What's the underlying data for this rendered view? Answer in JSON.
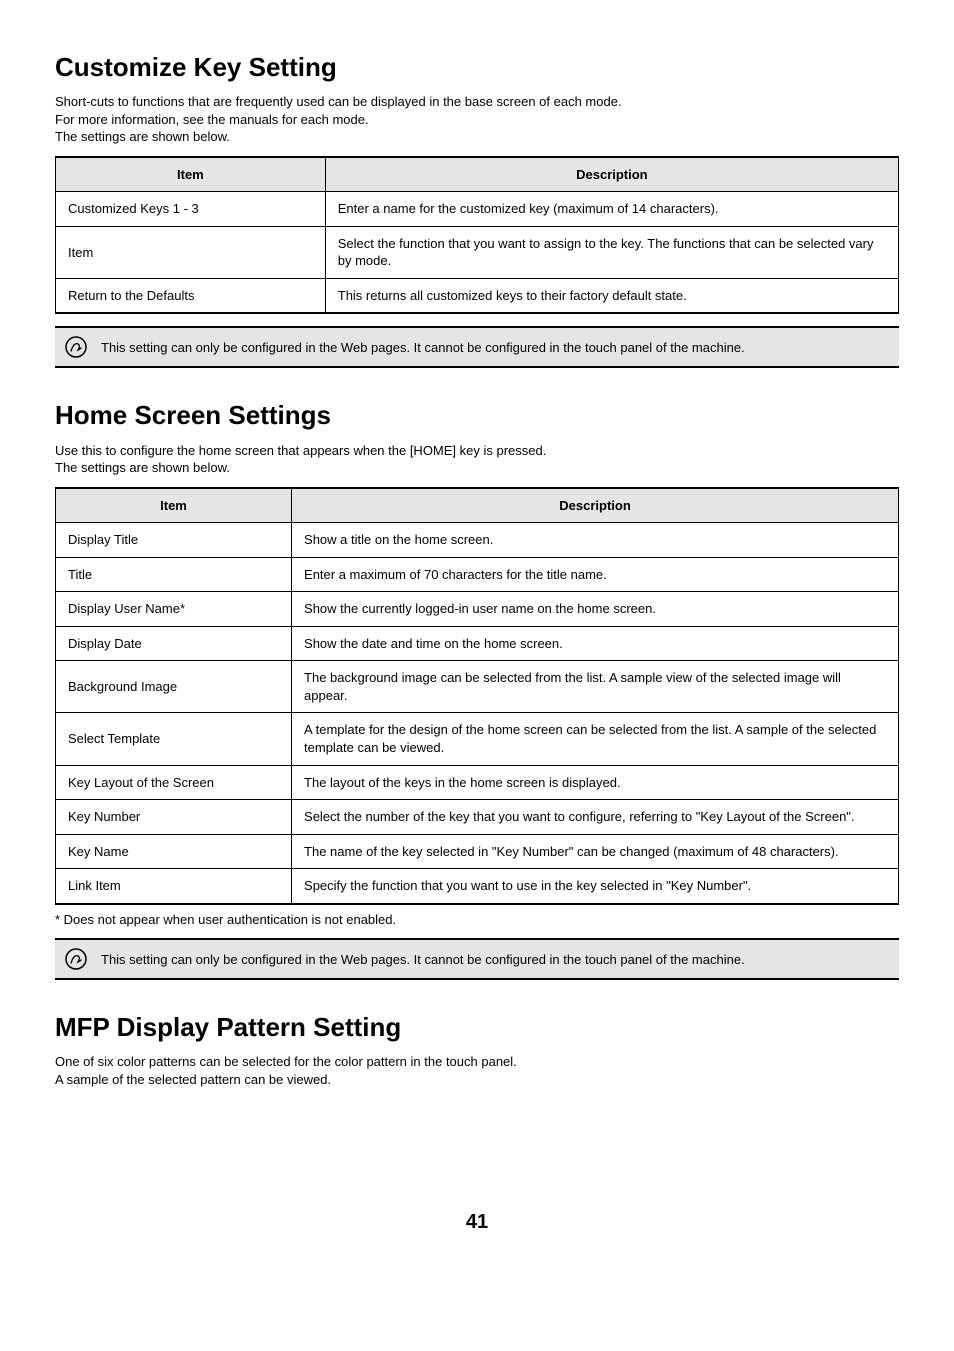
{
  "section1": {
    "title": "Customize Key Setting",
    "intro_lines": [
      "Short-cuts to functions that are frequently used can be displayed in the base screen of each mode.",
      "For more information, see the manuals for each mode.",
      "The settings are shown below."
    ],
    "table": {
      "headers": {
        "item": "Item",
        "desc": "Description"
      },
      "rows": [
        {
          "item": "Customized Keys 1 - 3",
          "desc": "Enter a name for the customized key (maximum of 14 characters)."
        },
        {
          "item": "Item",
          "desc": "Select the function that you want to assign to the key. The functions that can be selected vary by mode."
        },
        {
          "item": "Return to the Defaults",
          "desc": "This returns all customized keys to their factory default state."
        }
      ]
    },
    "note": "This setting can only be configured in the Web pages. It cannot be configured in the touch panel of the machine."
  },
  "section2": {
    "title": "Home Screen Settings",
    "intro_lines": [
      "Use this to configure the home screen that appears when the [HOME] key is pressed.",
      "The settings are shown below."
    ],
    "table": {
      "headers": {
        "item": "Item",
        "desc": "Description"
      },
      "rows": [
        {
          "item": "Display Title",
          "desc": "Show a title on the home screen."
        },
        {
          "item": "Title",
          "desc": "Enter a maximum of 70 characters for the title name."
        },
        {
          "item": "Display User Name*",
          "desc": "Show the currently logged-in user name on the home screen."
        },
        {
          "item": "Display Date",
          "desc": "Show the date and time on the home screen."
        },
        {
          "item": "Background Image",
          "desc": "The background image can be selected from the list. A sample view of the selected image will appear."
        },
        {
          "item": "Select Template",
          "desc": "A template for the design of the home screen can be selected from the list. A sample of the selected template can be viewed."
        },
        {
          "item": "Key Layout of the Screen",
          "desc": "The layout of the keys in the home screen is displayed."
        },
        {
          "item": "Key Number",
          "desc": "Select the number of the key that you want to configure, referring to \"Key Layout of the Screen\"."
        },
        {
          "item": "Key Name",
          "desc": "The name of the key selected in \"Key Number\" can be changed (maximum of 48 characters)."
        },
        {
          "item": "Link Item",
          "desc": "Specify the function that you want to use in the key selected in \"Key Number\"."
        }
      ]
    },
    "footnote": "*  Does not appear when user authentication is not enabled.",
    "note": "This setting can only be configured in the Web pages. It cannot be configured in the touch panel of the machine."
  },
  "section3": {
    "title": "MFP Display Pattern Setting",
    "intro_lines": [
      "One of six color patterns can be selected for the color pattern in the touch panel.",
      "A sample of the selected pattern can be viewed."
    ]
  },
  "page_number": "41"
}
